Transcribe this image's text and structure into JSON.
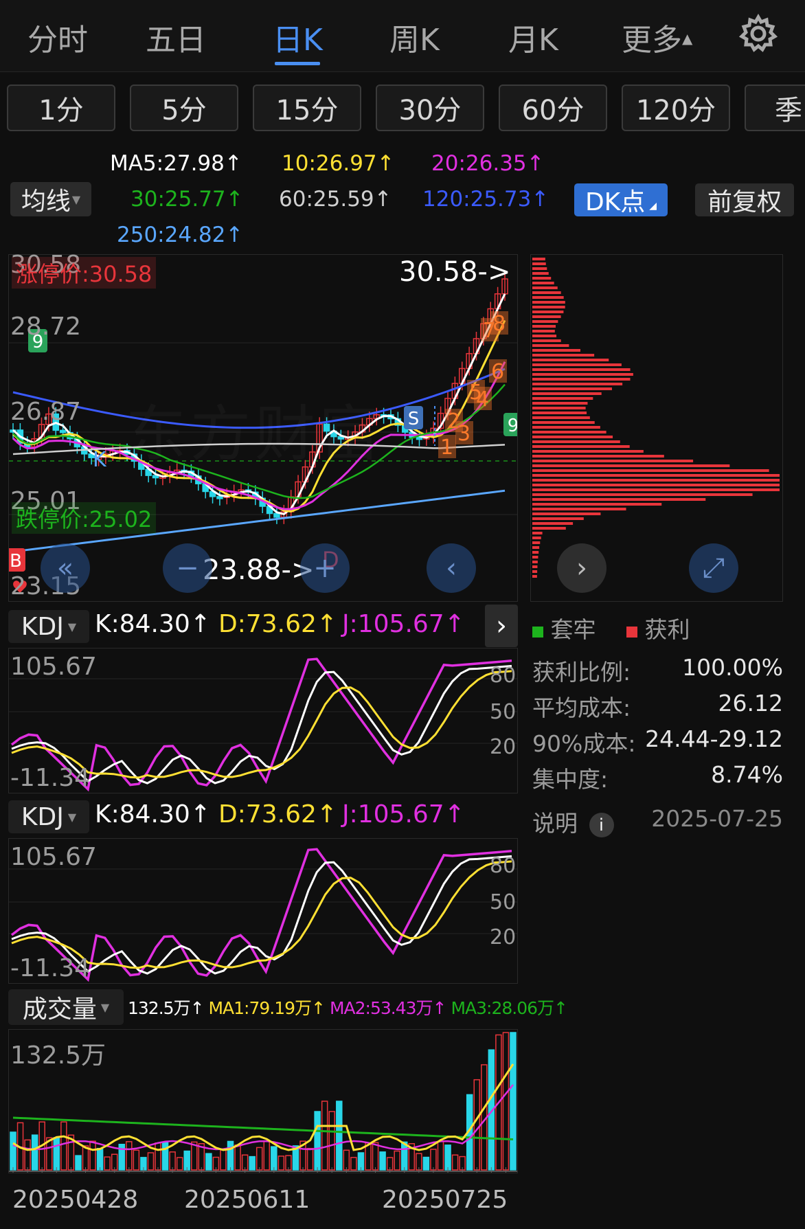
{
  "tabs": [
    {
      "label": "分时",
      "active": false
    },
    {
      "label": "五日",
      "active": false
    },
    {
      "label": "日K",
      "active": true
    },
    {
      "label": "周K",
      "active": false
    },
    {
      "label": "月K",
      "active": false
    },
    {
      "label": "更多",
      "active": false
    }
  ],
  "more_arrow": "▲",
  "periods": [
    "1分",
    "5分",
    "15分",
    "30分",
    "60分",
    "120分",
    "季"
  ],
  "ma_legend": {
    "selector": "均线",
    "items": [
      {
        "text": "MA5:27.98↑",
        "color": "#ffffff"
      },
      {
        "text": "10:26.97↑",
        "color": "#ffe033"
      },
      {
        "text": "20:26.35↑",
        "color": "#e030e0"
      },
      {
        "text": "30:25.77↑",
        "color": "#1db31d"
      },
      {
        "text": "60:25.59↑",
        "color": "#d0d0d0"
      },
      {
        "text": "120:25.73↑",
        "color": "#3b5bff"
      },
      {
        "text": "250:24.82↑",
        "color": "#5aa7ff"
      }
    ],
    "dk_button": "DK点",
    "fq_button": "前复权"
  },
  "main_chart": {
    "y_ticks": [
      "30.58",
      "28.72",
      "26.87",
      "25.01",
      "23.15"
    ],
    "limit_up_label": "涨停价:30.58",
    "limit_down_label": "跌停价:25.02",
    "high_marker": "30.58->",
    "low_marker": "23.88->",
    "watermark": "东方财富",
    "signals": {
      "k": "K",
      "b": "B",
      "s": "S",
      "d": "D",
      "nine_a": "9",
      "nine_b": "9"
    },
    "counts": [
      "1",
      "2",
      "3",
      "4",
      "5",
      "6",
      "7",
      "8"
    ],
    "ma_colors": {
      "ma5": "#ffffff",
      "ma10": "#ffe033",
      "ma20": "#e030e0",
      "ma30": "#1db31d",
      "ma60": "#d0d0d0",
      "ma120": "#3b5bff",
      "ma250": "#5aa7ff"
    }
  },
  "chip_distribution": {
    "legend": [
      {
        "label": "套牢",
        "color": "#1db31d"
      },
      {
        "label": "获利",
        "color": "#e8353b"
      }
    ],
    "rows": [
      {
        "label": "获利比例:",
        "value": "100.00%"
      },
      {
        "label": "平均成本:",
        "value": "26.12"
      },
      {
        "label": "90%成本:",
        "value": "24.44-29.12"
      },
      {
        "label": "集中度:",
        "value": "8.74%"
      }
    ],
    "note_label": "说明",
    "date": "2025-07-25"
  },
  "kdj1": {
    "selector": "KDJ",
    "k": "K:84.30↑",
    "d": "D:73.62↑",
    "j": "J:105.67↑",
    "y_max": "105.67",
    "y_min": "-11.34",
    "levels": [
      "80",
      "50",
      "20"
    ]
  },
  "kdj2": {
    "selector": "KDJ",
    "k": "K:84.30↑",
    "d": "D:73.62↑",
    "j": "J:105.67↑",
    "y_max": "105.67",
    "y_min": "-11.34",
    "levels": [
      "80",
      "50",
      "20"
    ]
  },
  "volume": {
    "selector": "成交量",
    "v": "132.5万↑",
    "ma1": "MA1:79.19万↑",
    "ma2": "MA2:53.43万↑",
    "ma3": "MA3:28.06万↑",
    "y_max": "132.5万",
    "dates": [
      "20250428",
      "20250611",
      "20250725"
    ]
  },
  "colors": {
    "up": "#e8353b",
    "down": "#29d6e8",
    "accent": "#4a8ff2"
  }
}
